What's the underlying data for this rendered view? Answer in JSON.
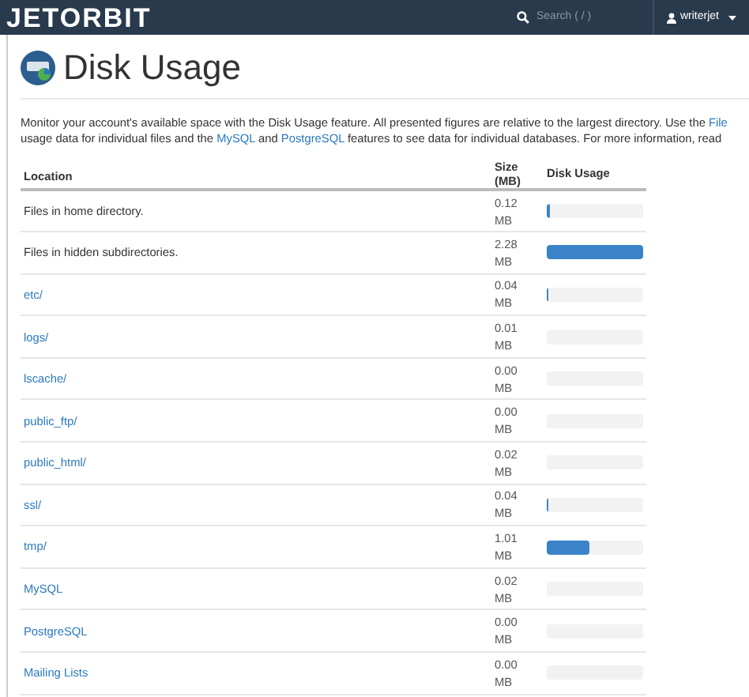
{
  "header": {
    "logo": "JETORBIT",
    "search": {
      "placeholder": "Search ( / )"
    },
    "user": "writerjet"
  },
  "page": {
    "title": "Disk Usage"
  },
  "description": [
    [
      {
        "kind": "text",
        "text": "Monitor your account's available space with the Disk Usage feature. All presented figures are relative to the largest directory. Use the "
      },
      {
        "kind": "link",
        "text": "File"
      }
    ],
    [
      {
        "kind": "text",
        "text": "usage data for individual files and the "
      },
      {
        "kind": "link",
        "text": "MySQL"
      },
      {
        "kind": "text",
        "text": " and "
      },
      {
        "kind": "link",
        "text": "PostgreSQL"
      },
      {
        "kind": "text",
        "text": " features to see data for individual databases. For more information, read"
      }
    ]
  ],
  "table": {
    "columns": [
      "Location",
      "Size (MB)",
      "Disk Usage"
    ],
    "rows": [
      {
        "location": "Files in home directory.",
        "link": false,
        "size": "0.12 MB",
        "level": 0.03
      },
      {
        "location": "Files in hidden subdirectories.",
        "link": false,
        "size": "2.28 MB",
        "level": 1
      },
      {
        "location": "etc/",
        "link": true,
        "size": "0.04 MB",
        "level": 0.02
      },
      {
        "location": "logs/",
        "link": true,
        "size": "0.01 MB",
        "level": 0
      },
      {
        "location": "lscache/",
        "link": true,
        "size": "0.00 MB",
        "level": 0
      },
      {
        "location": "public_ftp/",
        "link": true,
        "size": "0.00 MB",
        "level": 0
      },
      {
        "location": "public_html/",
        "link": true,
        "size": "0.02 MB",
        "level": 0
      },
      {
        "location": "ssl/",
        "link": true,
        "size": "0.04 MB",
        "level": 0.02
      },
      {
        "location": "tmp/",
        "link": true,
        "size": "1.01 MB",
        "level": 0.44
      },
      {
        "location": "MySQL",
        "link": true,
        "size": "0.02 MB",
        "level": 0
      },
      {
        "location": "PostgreSQL",
        "link": true,
        "size": "0.00 MB",
        "level": 0
      },
      {
        "location": "Mailing Lists",
        "link": true,
        "size": "0.00 MB",
        "level": 0
      }
    ]
  }
}
